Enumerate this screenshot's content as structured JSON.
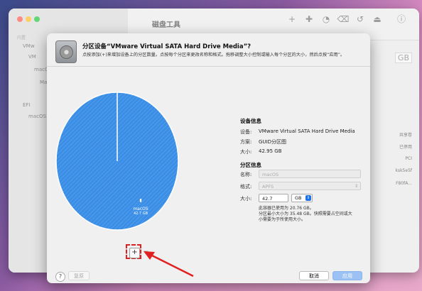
{
  "background_window": {
    "title": "磁盘工具",
    "sidebar_header": "内置",
    "sidebar_items": [
      "VMw",
      "VM",
      "macOS",
      "Ma",
      "EFI",
      "macOS"
    ],
    "right_fragments": [
      "GB",
      "共享卷",
      "已停用",
      "PCI",
      "ksk5e5f",
      "F80fA..."
    ]
  },
  "dialog": {
    "title": "分区设备“VMware Virtual SATA Hard Drive Media”?",
    "description": "点按添加(+)来增加设备上的分区数量。点按每个分区来更改名称和格式。拖移调整大小控制或输入每个分区的大小，然后点按“应用”。",
    "pie": {
      "partition_name": "macOS",
      "partition_size": "42.7 GB",
      "color": "#3a8ee6"
    },
    "add_button": "+",
    "remove_button": "−",
    "device_info": {
      "heading": "设备信息",
      "device_label": "设备:",
      "device_value": "VMware Virtual SATA Hard Drive Media",
      "scheme_label": "方案:",
      "scheme_value": "GUID分区图",
      "size_label": "大小:",
      "size_value": "42.95 GB"
    },
    "partition_info": {
      "heading": "分区信息",
      "name_label": "名称:",
      "name_value": "macOS",
      "format_label": "格式:",
      "format_value": "APFS",
      "size_label": "大小:",
      "size_value": "42.7",
      "unit_value": "GB",
      "note": [
        "此容器已使用为 20.76 GB。",
        "分区最小大小为 35.48 GB。快照需要占空间或大",
        "小需要为于所使用大小。"
      ]
    },
    "help_button": "?",
    "revert_button": "复原",
    "cancel_button": "取消",
    "apply_button": "应用"
  }
}
